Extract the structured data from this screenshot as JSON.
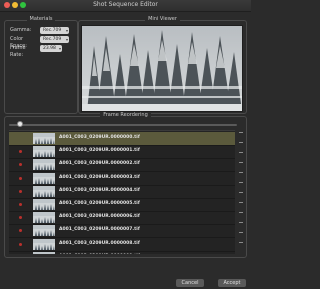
{
  "window": {
    "title": "Shot Sequence Editor"
  },
  "materials": {
    "title": "Materials",
    "fields": [
      {
        "label": "Gamma:",
        "value": "Rec.709"
      },
      {
        "label": "Color Space:",
        "value": "Rec.709"
      },
      {
        "label": "Frame Rate:",
        "value": "23.98"
      }
    ]
  },
  "mini_viewer": {
    "title": "Mini Viewer"
  },
  "frame_reordering": {
    "title": "Frame Reordering",
    "slider_position": 0.05,
    "files": [
      "A001_C003_0209UR.0000000.tif",
      "A001_C003_0209UR.0000001.tif",
      "A001_C003_0209UR.0000002.tif",
      "A001_C003_0209UR.0000003.tif",
      "A001_C003_0209UR.0000004.tif",
      "A001_C003_0209UR.0000005.tif",
      "A001_C003_0209UR.0000006.tif",
      "A001_C003_0209UR.0000007.tif",
      "A001_C003_0209UR.0000008.tif",
      "A001_C003_0209UR.0000009.tif"
    ],
    "selected_index": 0
  },
  "buttons": {
    "cancel": "Cancel",
    "accept": "Accept"
  },
  "colors": {
    "selected_row": "#5b5a3c",
    "marker": "#b9302c"
  }
}
